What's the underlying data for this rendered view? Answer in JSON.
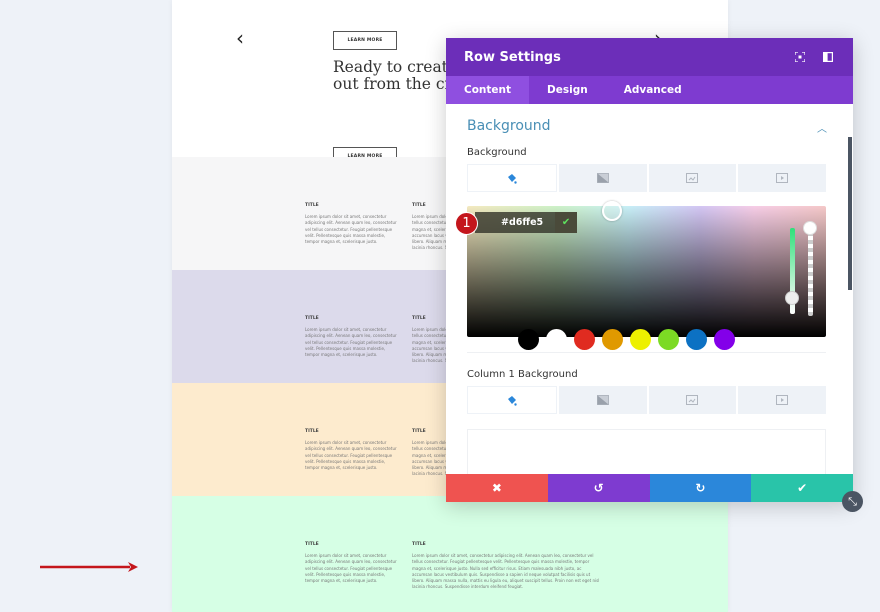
{
  "page": {
    "hero": {
      "prev_arrow": "‹",
      "next_arrow": "›",
      "learn_more_top": "LEARN MORE",
      "heading": "Ready to create a website that stands out from the crowd?",
      "learn_more_bottom": "LEARN MORE"
    },
    "bands": [
      {
        "bg": "#f6f6f7",
        "col1_title": "TITLE",
        "col1_body": "Lorem ipsum dolor sit amet, consectetur adipiscing elit. Aenean quam leo, consectetur vel tellus consectetur. Feugiat pellentesque velit. Pellentesque quis massa molestie, tempor magna et, scelerisque justo.",
        "col2_title": "TITLE",
        "col2_body": "Lorem ipsum dolor sit amet, consectetur adipiscing elit. Aenean quam leo, consectetur vel tellus consectetur. Feugiat pellentesque velit. Pellentesque quis massa molestie, tempor magna et, scelerisque justo. Nulla sed efficitur risus. Etiam malesuada nibh justo, ac accumsan lacus vestibulum quis. Suspendisse a sapien id neque volutpat facilisis quis ut libero. Aliquam massa nulla, mattis eu ligula eu, aliquet suscipit tellus. Proin non est eget nisl lacinia rhoncus. Suspendisse interdum eleifend feugiat."
      },
      {
        "bg": "#dcdaeb",
        "col1_title": "TITLE",
        "col1_body": "Lorem ipsum dolor sit amet, consectetur adipiscing elit. Aenean quam leo, consectetur vel tellus consectetur. Feugiat pellentesque velit. Pellentesque quis massa molestie, tempor magna et, scelerisque justo.",
        "col2_title": "TITLE",
        "col2_body": "Lorem ipsum dolor sit amet, consectetur adipiscing elit. Aenean quam leo, consectetur vel tellus consectetur. Feugiat pellentesque velit. Pellentesque quis massa molestie, tempor magna et, scelerisque justo. Nulla sed efficitur risus. Etiam malesuada nibh justo, ac accumsan lacus vestibulum quis. Suspendisse a sapien id neque volutpat facilisis quis ut libero. Aliquam massa nulla, mattis eu ligula eu, aliquet suscipit tellus. Proin non est eget nisl lacinia rhoncus. Suspendisse interdum eleifend feugiat."
      },
      {
        "bg": "#fdebce",
        "col1_title": "TITLE",
        "col1_body": "Lorem ipsum dolor sit amet, consectetur adipiscing elit. Aenean quam leo, consectetur vel tellus consectetur. Feugiat pellentesque velit. Pellentesque quis massa molestie, tempor magna et, scelerisque justo.",
        "col2_title": "TITLE",
        "col2_body": "Lorem ipsum dolor sit amet, consectetur adipiscing elit. Aenean quam leo, consectetur vel tellus consectetur. Feugiat pellentesque velit. Pellentesque quis massa molestie, tempor magna et, scelerisque justo. Nulla sed efficitur risus. Etiam malesuada nibh justo, ac accumsan lacus vestibulum quis. Suspendisse a sapien id neque volutpat facilisis quis ut libero. Aliquam massa nulla, mattis eu ligula eu, aliquet suscipit tellus. Proin non est eget nisl lacinia rhoncus. Suspendisse interdum eleifend feugiat."
      },
      {
        "bg": "#d6ffe5",
        "col1_title": "TITLE",
        "col1_body": "Lorem ipsum dolor sit amet, consectetur adipiscing elit. Aenean quam leo, consectetur vel tellus consectetur. Feugiat pellentesque velit. Pellentesque quis massa molestie, tempor magna et, scelerisque justo.",
        "col2_title": "TITLE",
        "col2_body": "Lorem ipsum dolor sit amet, consectetur adipiscing elit. Aenean quam leo, consectetur vel tellus consectetur. Feugiat pellentesque velit. Pellentesque quis massa molestie, tempor magna et, scelerisque justo. Nulla sed efficitur risus. Etiam malesuada nibh justo, ac accumsan lacus vestibulum quis. Suspendisse a sapien id neque volutpat facilisis quis ut libero. Aliquam massa nulla, mattis eu ligula eu, aliquet suscipit tellus. Proin non est eget nisl lacinia rhoncus. Suspendisse interdum eleifend feugiat."
      }
    ]
  },
  "annotation": {
    "step_number": "1",
    "arrow_color": "#c4161c"
  },
  "modal": {
    "title": "Row Settings",
    "header_icons": [
      "focus-icon",
      "sidebar-layout-icon"
    ],
    "tabs": [
      {
        "label": "Content",
        "active": true
      },
      {
        "label": "Design",
        "active": false
      },
      {
        "label": "Advanced",
        "active": false
      }
    ],
    "section_title": "Background",
    "background_label": "Background",
    "background_type_tabs": [
      "color-fill-icon",
      "gradient-icon",
      "image-icon",
      "video-icon"
    ],
    "color_picker": {
      "hex_value": "#d6ffe5",
      "confirm_icon": "✔",
      "swatches": [
        "#000000",
        "#ffffff",
        "#e02b20",
        "#e09900",
        "#edf000",
        "#7cda24",
        "#0c71c3",
        "#8300e9"
      ]
    },
    "column1_label": "Column 1 Background",
    "footer": {
      "cancel_icon": "✖",
      "undo_icon": "↺",
      "redo_icon": "↻",
      "save_icon": "✔"
    },
    "colors": {
      "header": "#6c2eb9",
      "tabs": "#7e3bd0",
      "cancel": "#ef5350",
      "undo": "#7e3bd0",
      "redo": "#2b87da",
      "save": "#29c4a9"
    }
  }
}
